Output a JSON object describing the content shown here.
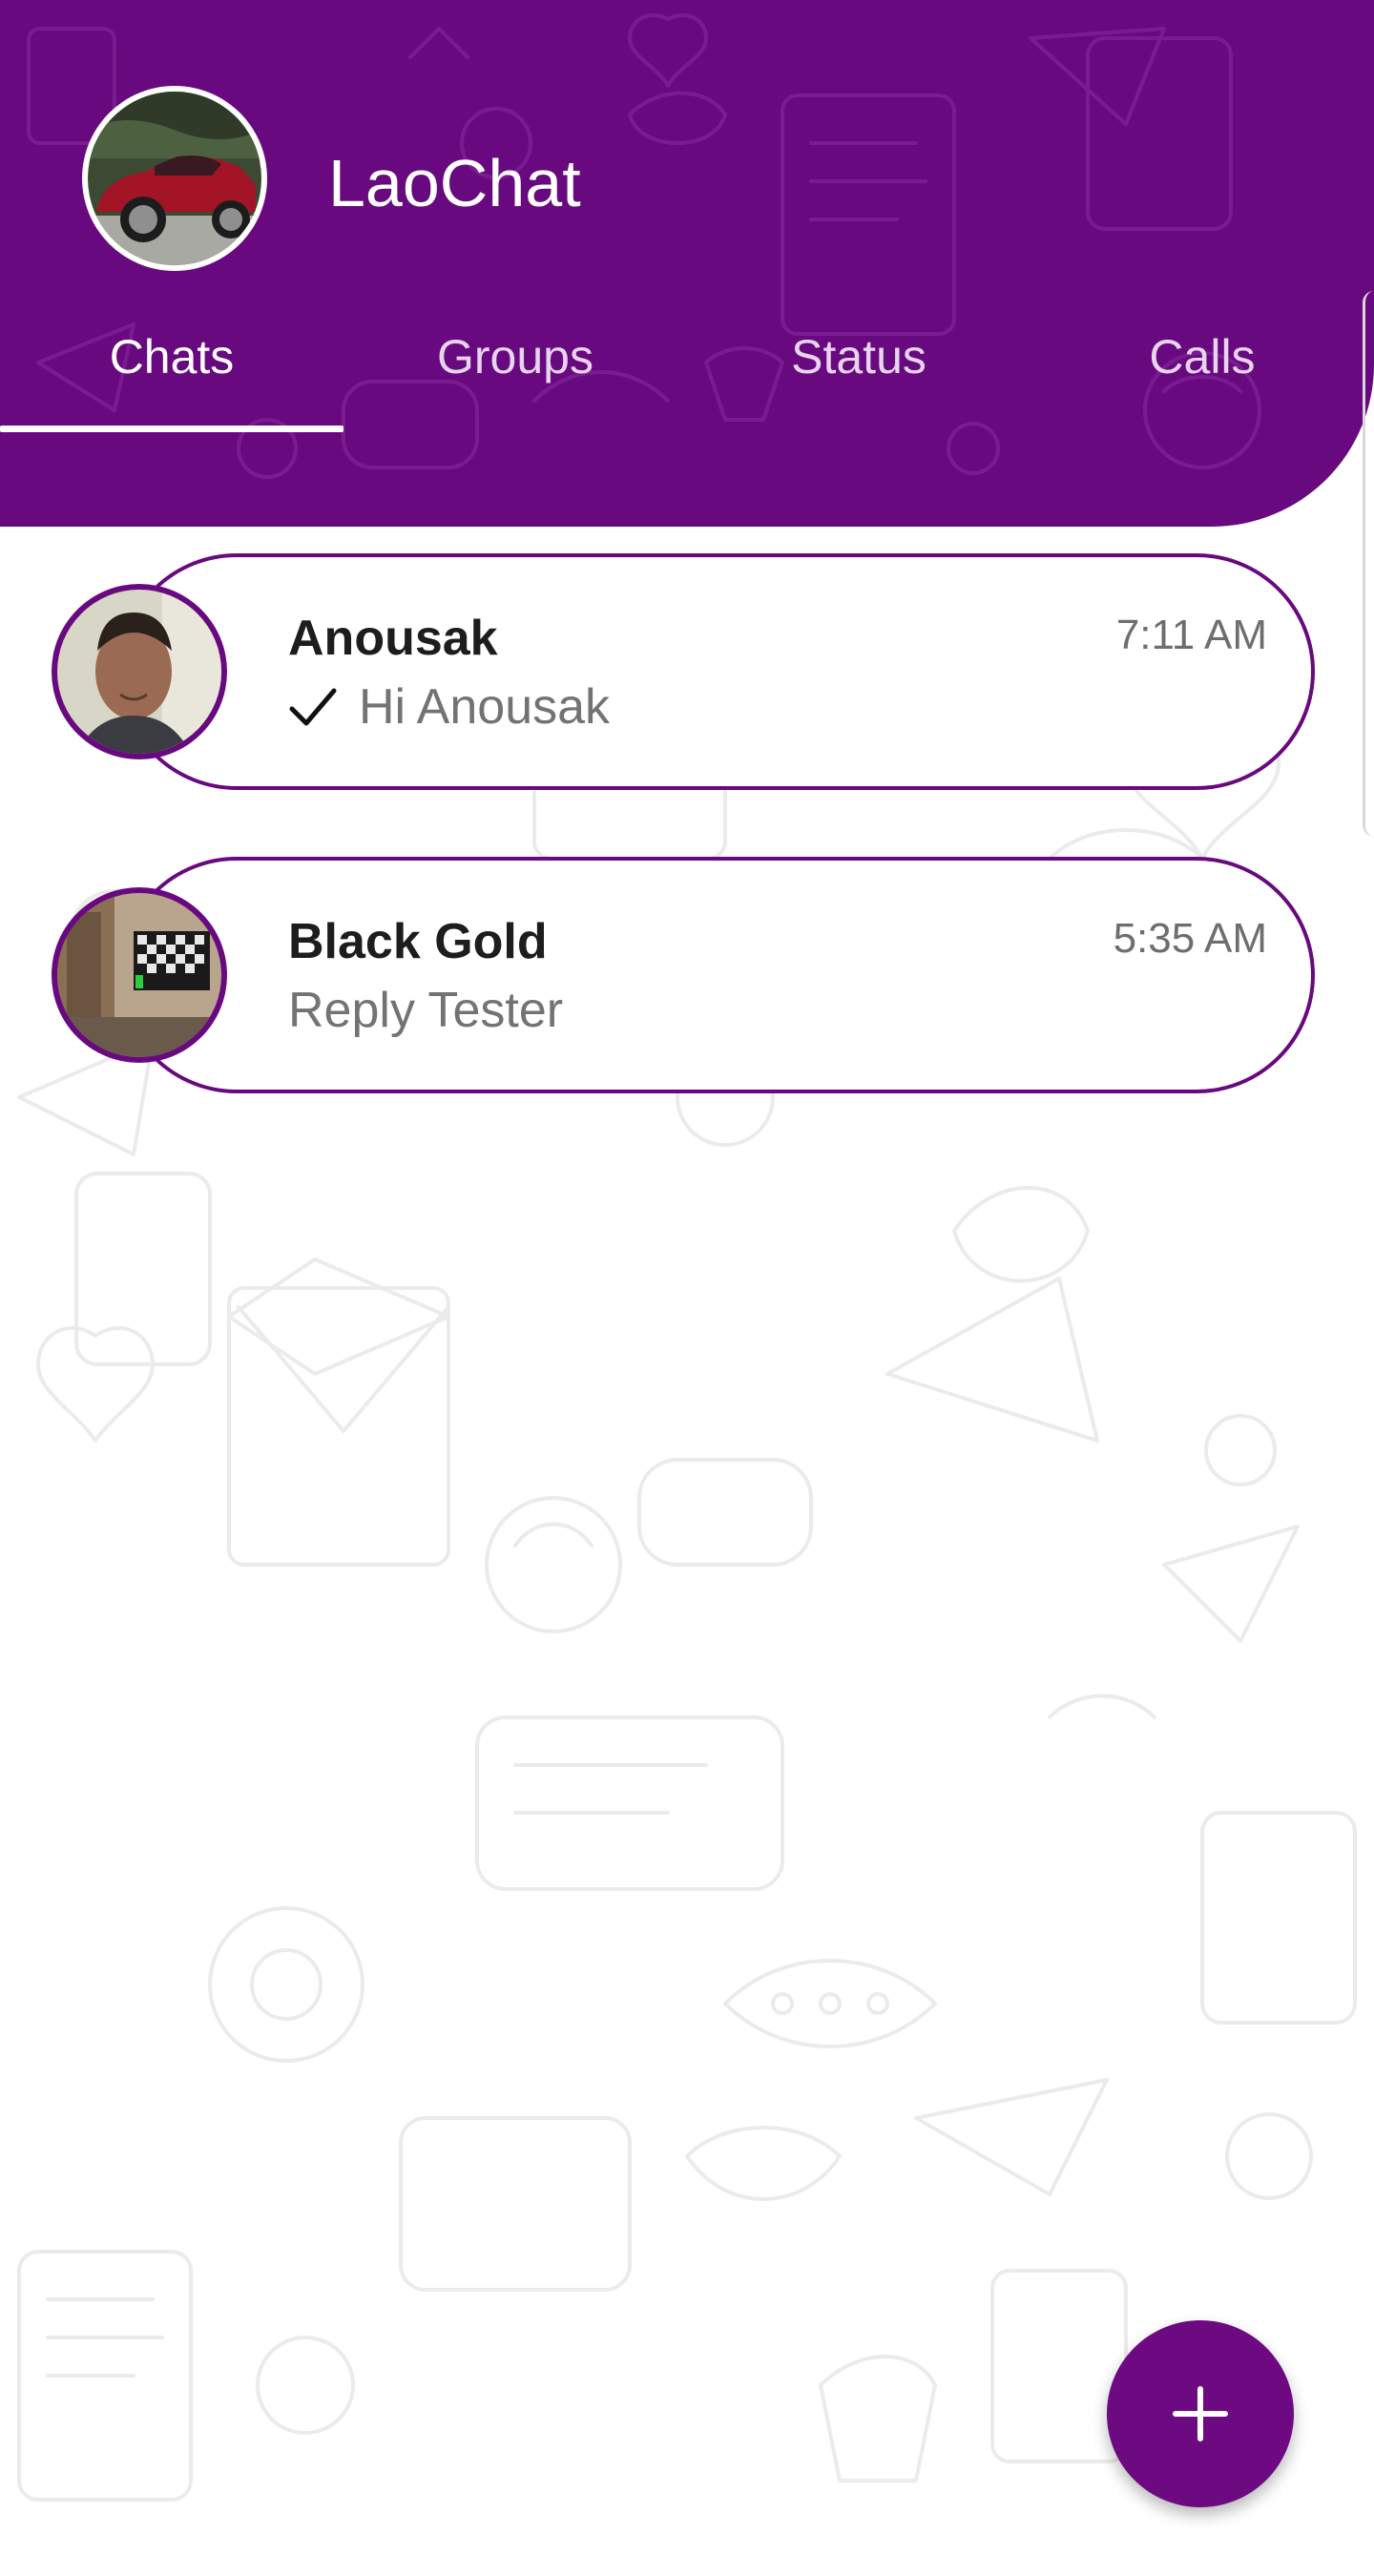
{
  "app": {
    "title": "LaoChat",
    "accent_color": "#69097f"
  },
  "profile": {
    "avatar_icon": "profile-photo-red-car"
  },
  "tabs": [
    {
      "label": "Chats",
      "active": true
    },
    {
      "label": "Groups",
      "active": false
    },
    {
      "label": "Status",
      "active": false
    },
    {
      "label": "Calls",
      "active": false
    }
  ],
  "chats": [
    {
      "name": "Anousak",
      "preview": "Hi Anousak",
      "time": "7:11 AM",
      "delivered_icon": "check-icon",
      "avatar_icon": "person-photo"
    },
    {
      "name": "Black Gold",
      "preview": "Reply Tester",
      "time": "5:35 AM",
      "avatar_icon": "room-photo"
    }
  ],
  "fab": {
    "icon": "plus-icon"
  }
}
